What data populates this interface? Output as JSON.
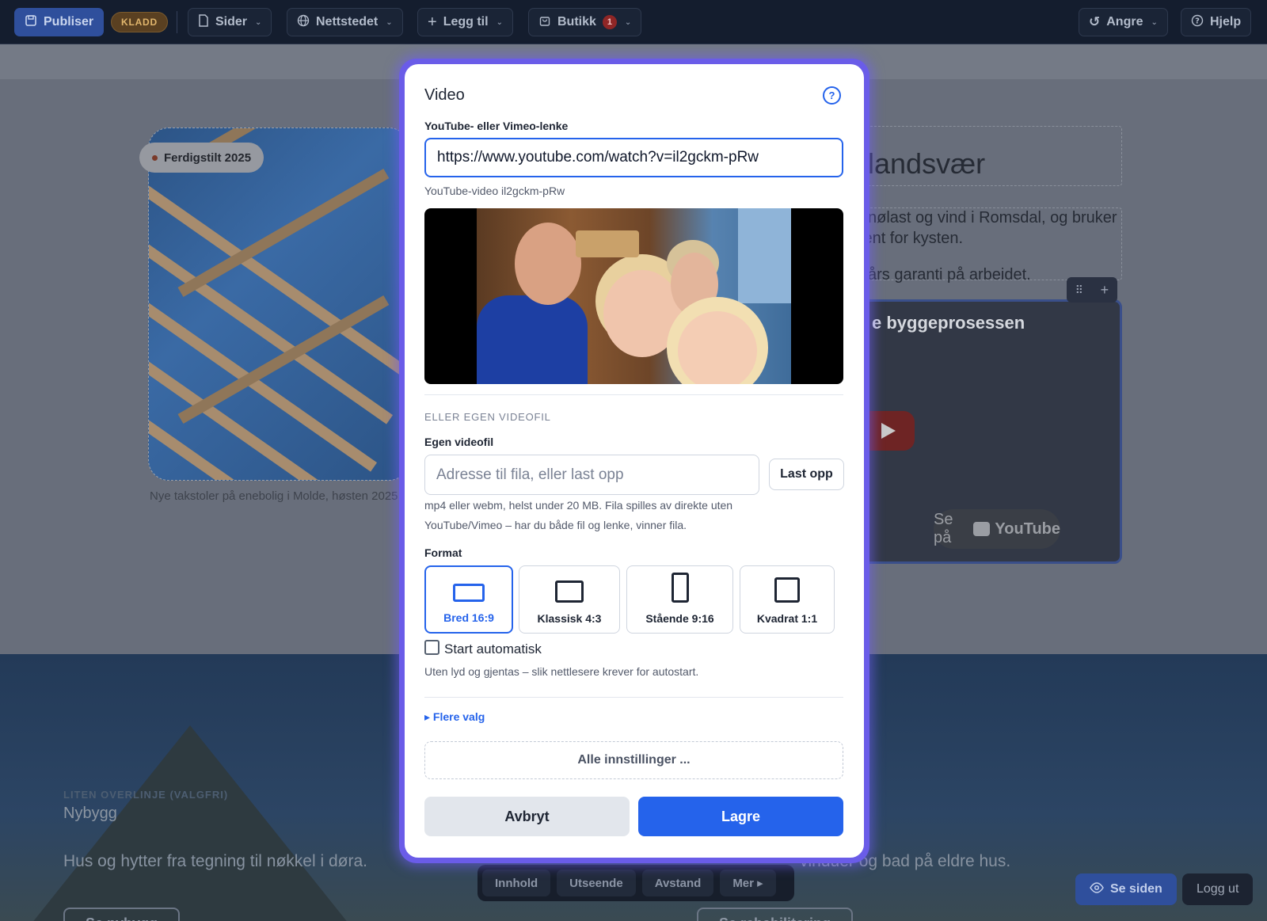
{
  "topbar": {
    "publish_label": "Publiser",
    "draft_badge": "KLADD",
    "pages_label": "Sider",
    "site_label": "Nettstedet",
    "add_label": "Legg til",
    "shop_label": "Butikk",
    "shop_count": "1",
    "undo_label": "Angre",
    "help_label": "Hjelp"
  },
  "page": {
    "photo_chip": "Ferdigstilt 2025",
    "photo_caption": "Nye takstoler på enebolig i Molde, høsten 2025",
    "heading_fragment": "tlandsvær",
    "para1_line1": "snølast og vind i Romsdal, og bruker",
    "para1_line2": "jent for kysten.",
    "para2": "i års garanti på arbeidet.",
    "video_card_title": "e byggeprosessen",
    "video_card_watch": "Se på",
    "video_card_brand": "YouTube",
    "video_card_ctrl_drag": "⠿",
    "video_card_ctrl_add": "+"
  },
  "hero": {
    "overline_placeholder": "LITEN OVERLINJE (VALGFRI)",
    "overline_value": "Nybygg",
    "left_text": "Hus og hytter fra tegning til nøkkel i døra.",
    "left_button": "Se nybygg",
    "right_text": "vinduer og bad på eldre hus.",
    "right_button": "Se rehabilitering"
  },
  "dock": {
    "tabs": [
      "Innhold",
      "Utseende",
      "Avstand",
      "Mer ▸"
    ]
  },
  "footer": {
    "view_site": "Se siden",
    "logout": "Logg ut"
  },
  "modal": {
    "title": "Video",
    "help_icon_text": "?",
    "url_label": "YouTube- eller Vimeo-lenke",
    "url_value": "https://www.youtube.com/watch?v=il2gckm-pRw",
    "url_hint": "YouTube-video il2gckm-pRw",
    "section_label": "ELLER EGEN VIDEOFIL",
    "file_label": "Egen videofil",
    "file_placeholder": "Adresse til fila, eller last opp",
    "upload_button": "Last opp",
    "file_hint_line1": "mp4 eller webm, helst under 20 MB. Fila spilles av direkte uten",
    "file_hint_line2": "YouTube/Vimeo – har du både fil og lenke, vinner fila.",
    "format_label": "Format",
    "formats": [
      {
        "label": "Bred 16:9",
        "selected": true
      },
      {
        "label": "Klassisk 4:3",
        "selected": false
      },
      {
        "label": "Stående 9:16",
        "selected": false
      },
      {
        "label": "Kvadrat 1:1",
        "selected": false
      }
    ],
    "autoplay_label": "Start automatisk",
    "autoplay_checked": false,
    "autoplay_hint": "Uten lyd og gjentas – slik nettlesere krever for autostart.",
    "more_options": "▸ Flere valg",
    "all_settings": "Alle innstillinger ...",
    "cancel_button": "Avbryt",
    "save_button": "Lagre"
  },
  "colors": {
    "accent": "#2563eb",
    "modal_ring": "#6a5ce8",
    "topbar_bg": "#141d2e"
  }
}
